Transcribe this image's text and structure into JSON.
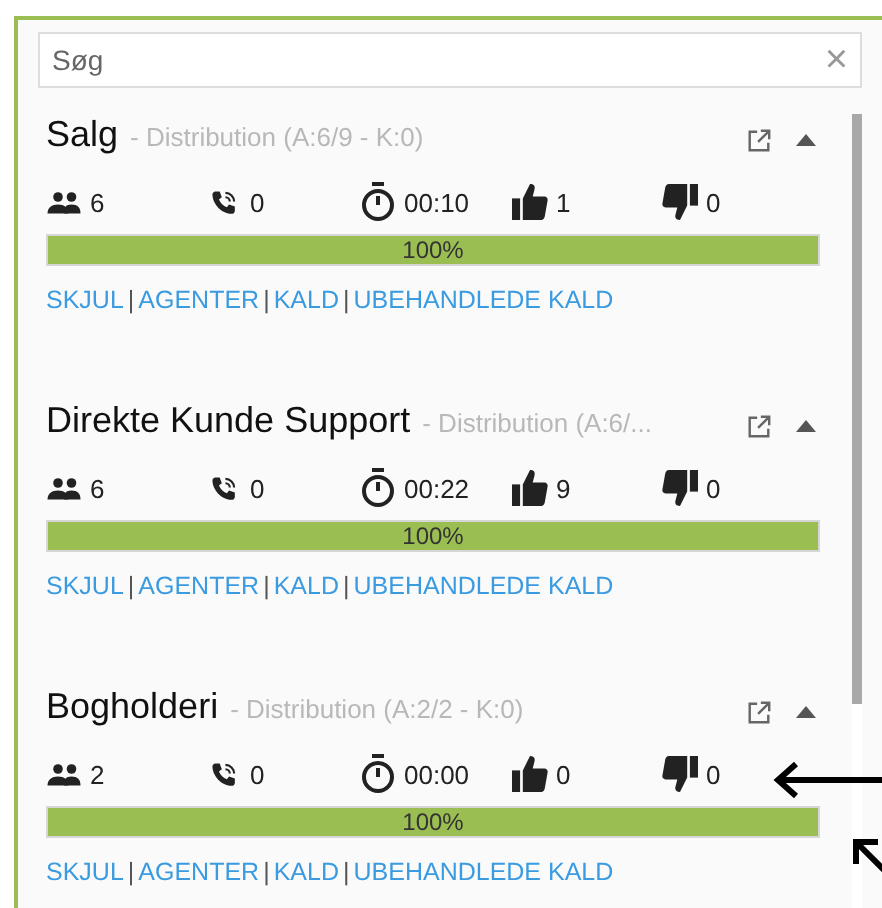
{
  "search": {
    "placeholder": "Søg",
    "clear": "×"
  },
  "queues": [
    {
      "name": "Salg",
      "subtitle": "- Distribution (A:6/9 - K:0)",
      "expanded": true,
      "stats": [
        {
          "kind": "agents",
          "value": "6"
        },
        {
          "kind": "calls",
          "value": "0"
        },
        {
          "kind": "time",
          "value": "00:10"
        },
        {
          "kind": "likes",
          "value": "1"
        },
        {
          "kind": "dislikes",
          "value": "0"
        }
      ],
      "level": 1,
      "reading": "100%",
      "links": [
        {
          "kind": "link",
          "text": "SKJUL"
        },
        {
          "kind": "separator",
          "text": "|"
        },
        {
          "kind": "link",
          "text": "AGENTER"
        },
        {
          "kind": "separator",
          "text": "|"
        },
        {
          "kind": "link",
          "text": "KALD"
        },
        {
          "kind": "separator",
          "text": "|"
        },
        {
          "kind": "link",
          "text": "UBEHANDLEDE KALD"
        }
      ]
    },
    {
      "name": "Direkte Kunde Support",
      "subtitle": "- Distribution (A:6/...",
      "expanded": true,
      "stats": [
        {
          "kind": "agents",
          "value": "6"
        },
        {
          "kind": "calls",
          "value": "0"
        },
        {
          "kind": "time",
          "value": "00:22"
        },
        {
          "kind": "likes",
          "value": "9"
        },
        {
          "kind": "dislikes",
          "value": "0"
        }
      ],
      "level": 1,
      "reading": "100%",
      "links": [
        {
          "kind": "link",
          "text": "SKJUL"
        },
        {
          "kind": "separator",
          "text": "|"
        },
        {
          "kind": "link",
          "text": "AGENTER"
        },
        {
          "kind": "separator",
          "text": "|"
        },
        {
          "kind": "link",
          "text": "KALD"
        },
        {
          "kind": "separator",
          "text": "|"
        },
        {
          "kind": "link",
          "text": "UBEHANDLEDE KALD"
        }
      ]
    },
    {
      "name": "Bogholderi",
      "subtitle": "- Distribution (A:2/2 - K:0)",
      "expanded": true,
      "stats": [
        {
          "kind": "agents",
          "value": "2"
        },
        {
          "kind": "calls",
          "value": "0"
        },
        {
          "kind": "time",
          "value": "00:00"
        },
        {
          "kind": "likes",
          "value": "0"
        },
        {
          "kind": "dislikes",
          "value": "0"
        }
      ],
      "level": 1,
      "reading": "100%",
      "links": [
        {
          "kind": "link",
          "text": "SKJUL"
        },
        {
          "kind": "separator",
          "text": "|"
        },
        {
          "kind": "link",
          "text": "AGENTER"
        },
        {
          "kind": "separator",
          "text": "|"
        },
        {
          "kind": "link",
          "text": "KALD"
        },
        {
          "kind": "separator",
          "text": "|"
        },
        {
          "kind": "link",
          "text": "UBEHANDLEDE KALD"
        }
      ]
    }
  ]
}
